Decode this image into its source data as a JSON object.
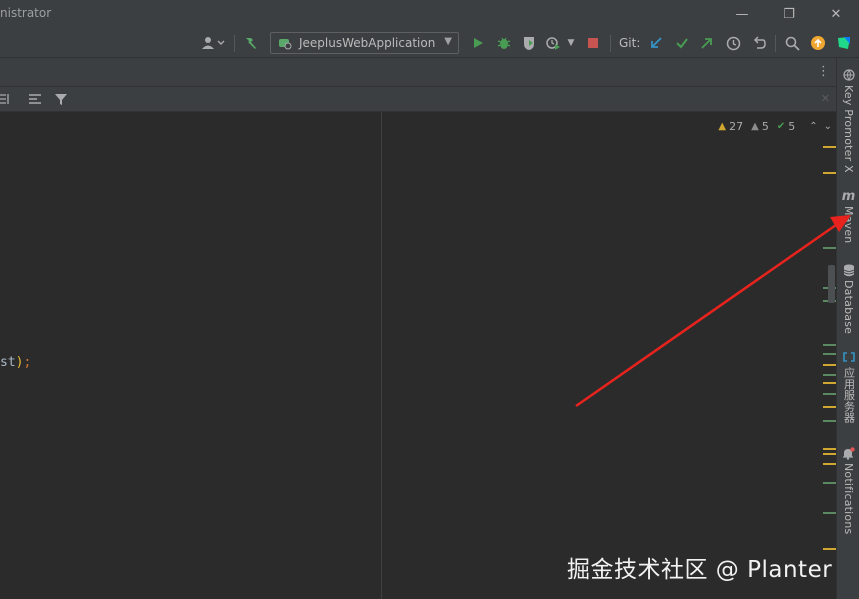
{
  "window": {
    "title": "nistrator",
    "minimize": "—",
    "restore": "❐",
    "close": "✕"
  },
  "toolbar": {
    "run_config_label": "JeeplusWebApplication",
    "git_label": "Git:"
  },
  "inspection": {
    "warnings": "27",
    "weak_warnings": "5",
    "typos": "5"
  },
  "code": {
    "tail_text": "st",
    "paren": ")",
    "semi": ";"
  },
  "side_tools": {
    "key_promoter": "Key Promoter X",
    "maven": "Maven",
    "maven_glyph": "m",
    "database": "Database",
    "app_server": "应用服务器",
    "notifications": "Notifications"
  },
  "watermark": "掘金技术社区 @ Planter",
  "colors": {
    "bg_editor": "#2b2b2b",
    "bg_panel": "#3c3f41",
    "run_green": "#499c54",
    "stop_red": "#c75450",
    "git_blue": "#3592c4",
    "warning_yellow": "#d0a730",
    "arrow_red": "#e8231d",
    "stripe_green": "#5b8a62"
  }
}
